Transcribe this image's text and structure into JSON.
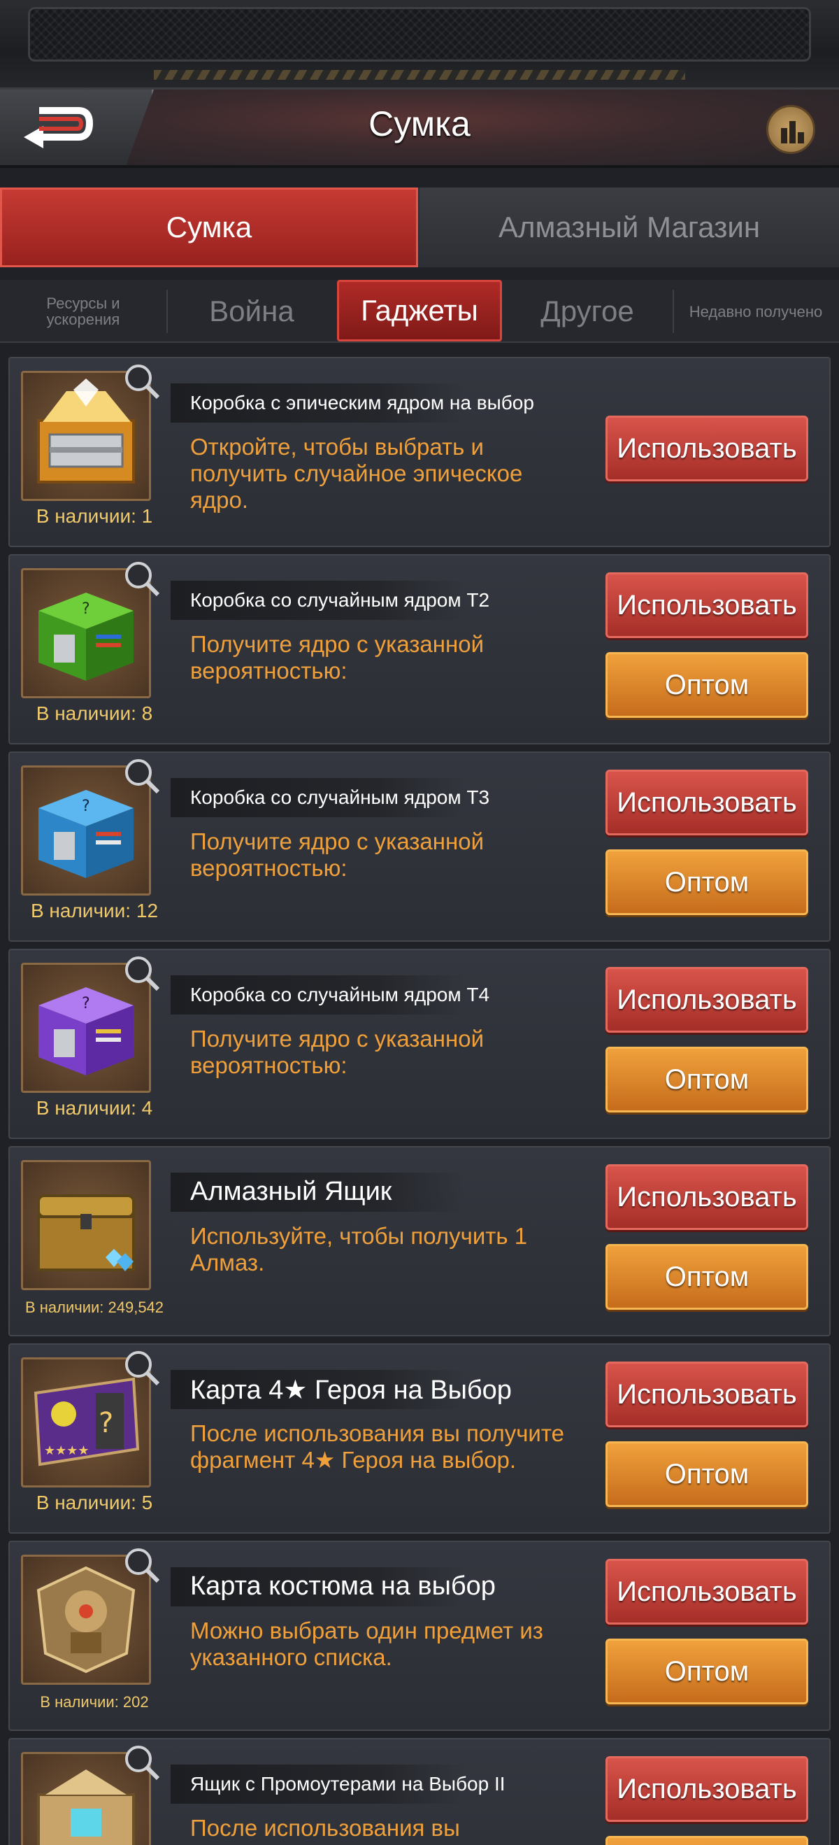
{
  "header": {
    "title": "Сумка"
  },
  "main_tabs": [
    {
      "label": "Сумка",
      "active": true
    },
    {
      "label": "Алмазный Магазин",
      "active": false
    }
  ],
  "sub_tabs": [
    {
      "label": "Ресурсы и ускорения",
      "active": false
    },
    {
      "label": "Война",
      "active": false
    },
    {
      "label": "Гаджеты",
      "active": true
    },
    {
      "label": "Другое",
      "active": false
    },
    {
      "label": "Недавно получено",
      "active": false
    }
  ],
  "buttons": {
    "use": "Использовать",
    "bulk": "Оптом"
  },
  "items": [
    {
      "name": "Коробка с эпическим ядром на выбор",
      "description": "Откройте, чтобы выбрать и получить случайное эпическое ядро.",
      "quantity": "В наличии: 1",
      "icon": "epic-core-box-icon",
      "has_bulk": false
    },
    {
      "name": "Коробка со случайным ядром T2",
      "description": "Получите ядро с указанной вероятностью:",
      "quantity": "В наличии: 8",
      "icon": "green-core-box-icon",
      "has_bulk": true
    },
    {
      "name": "Коробка со случайным ядром T3",
      "description": "Получите ядро с указанной вероятностью:",
      "quantity": "В наличии: 12",
      "icon": "blue-core-box-icon",
      "has_bulk": true
    },
    {
      "name": "Коробка со случайным ядром T4",
      "description": "Получите ядро с указанной вероятностью:",
      "quantity": "В наличии: 4",
      "icon": "purple-core-box-icon",
      "has_bulk": true
    },
    {
      "name": "Алмазный Ящик",
      "description": "Используйте, чтобы получить 1 Алмаз.",
      "quantity": "В наличии: 249,542",
      "icon": "diamond-chest-icon",
      "has_bulk": true
    },
    {
      "name": "Карта 4★ Героя на Выбор",
      "description": "После использования вы получите фрагмент 4★ Героя на выбор.",
      "quantity": "В наличии: 5",
      "icon": "hero-card-icon",
      "has_bulk": true
    },
    {
      "name": "Карта костюма на выбор",
      "description": "Можно выбрать один предмет из указанного списка.",
      "quantity": "В наличии: 202",
      "icon": "costume-card-icon",
      "has_bulk": true
    },
    {
      "name": "Ящик с Промоутерами на Выбор II",
      "description": "После использования вы",
      "quantity": "",
      "icon": "promoter-box-icon",
      "has_bulk": true
    }
  ]
}
